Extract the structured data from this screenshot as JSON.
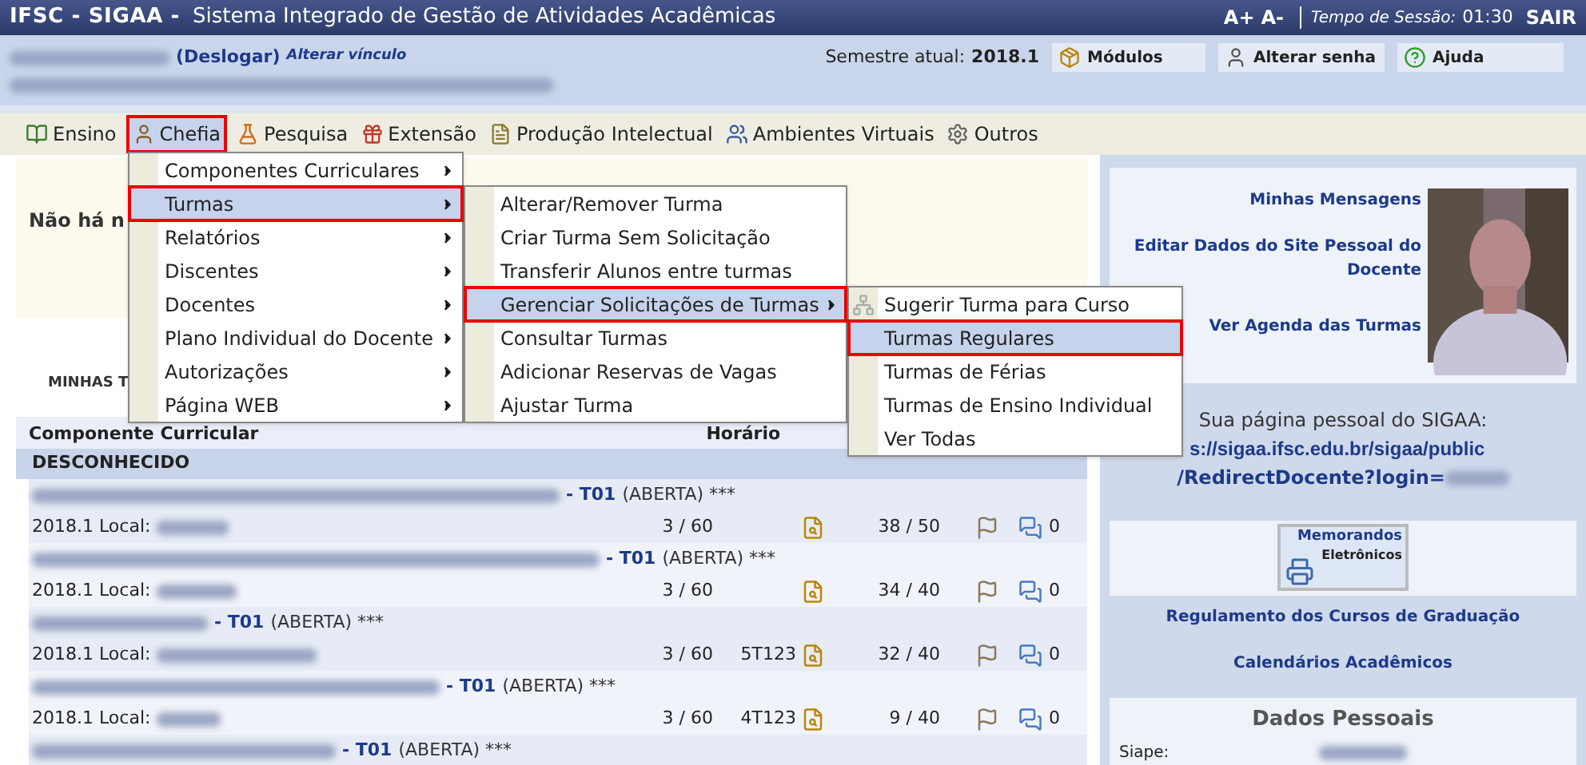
{
  "header": {
    "system": "IFSC - SIGAA -",
    "title": "Sistema Integrado de Gestão de Atividades Acadêmicas",
    "font_up": "A+",
    "font_down": "A-",
    "session_label": "Tempo de Sessão:",
    "session_time": "01:30",
    "logout": "SAIR"
  },
  "user_bar": {
    "logout_link": "(Deslogar)",
    "change_link": "Alterar vínculo",
    "semester_label": "Semestre atual:",
    "semester": "2018.1",
    "buttons": [
      "Módulos",
      "Alterar senha",
      "Ajuda"
    ]
  },
  "menu_bar": [
    {
      "label": "Ensino",
      "selected": false
    },
    {
      "label": "Chefia",
      "selected": true
    },
    {
      "label": "Pesquisa",
      "selected": false
    },
    {
      "label": "Extensão",
      "selected": false
    },
    {
      "label": "Produção Intelectual",
      "selected": false
    },
    {
      "label": "Ambientes Virtuais",
      "selected": false
    },
    {
      "label": "Outros",
      "selected": false
    }
  ],
  "menus": [
    {
      "items": [
        {
          "label": "Componentes Curriculares",
          "selected": false,
          "submenu": true
        },
        {
          "label": "Turmas",
          "selected": true,
          "submenu": true
        },
        {
          "label": "Relatórios",
          "selected": false,
          "submenu": true
        },
        {
          "label": "Discentes",
          "selected": false,
          "submenu": true
        },
        {
          "label": "Docentes",
          "selected": false,
          "submenu": true
        },
        {
          "label": "Plano Individual do Docente",
          "selected": false,
          "submenu": true
        },
        {
          "label": "Autorizações",
          "selected": false,
          "submenu": true
        },
        {
          "label": "Página WEB",
          "selected": false,
          "submenu": true
        }
      ]
    },
    {
      "items": [
        {
          "label": "Alterar/Remover Turma",
          "selected": false,
          "submenu": false
        },
        {
          "label": "Criar Turma Sem Solicitação",
          "selected": false,
          "submenu": false
        },
        {
          "label": "Transferir Alunos entre turmas",
          "selected": false,
          "submenu": false
        },
        {
          "label": "Gerenciar Solicitações de Turmas",
          "selected": true,
          "submenu": true
        },
        {
          "label": "Consultar Turmas",
          "selected": false,
          "submenu": false
        },
        {
          "label": "Adicionar Reservas de Vagas",
          "selected": false,
          "submenu": false
        },
        {
          "label": "Ajustar Turma",
          "selected": false,
          "submenu": false
        }
      ]
    },
    {
      "items": [
        {
          "label": "Sugerir Turma para Curso",
          "selected": false,
          "submenu": false
        },
        {
          "label": "Turmas Regulares",
          "selected": true,
          "submenu": false
        },
        {
          "label": "Turmas de Férias",
          "selected": false,
          "submenu": false
        },
        {
          "label": "Turmas de Ensino Individual",
          "selected": false,
          "submenu": false
        },
        {
          "label": "Ver Todas",
          "selected": false,
          "submenu": false
        }
      ]
    }
  ],
  "notice": "Não há n",
  "section_title": "MINHAS T",
  "table": {
    "columns": [
      "Componente Curricular",
      "Horário"
    ],
    "group": "DESCONHECIDO",
    "rows": [
      {
        "code": "- T01",
        "status": "(ABERTA) ***",
        "period": "2018.1 Local:",
        "workload": "3 / 60",
        "schedule": "",
        "seats": "38 / 50",
        "messages": "0"
      },
      {
        "code": "- T01",
        "status": "(ABERTA) ***",
        "period": "2018.1 Local:",
        "workload": "3 / 60",
        "schedule": "",
        "seats": "34 / 40",
        "messages": "0"
      },
      {
        "code": "- T01",
        "status": "(ABERTA) ***",
        "period": "2018.1 Local:",
        "workload": "3 / 60",
        "schedule": "5T123",
        "seats": "32 / 40",
        "messages": "0"
      },
      {
        "code": "- T01",
        "status": "(ABERTA) ***",
        "period": "2018.1 Local:",
        "workload": "3 / 60",
        "schedule": "4T123",
        "seats": "9 / 40",
        "messages": "0"
      },
      {
        "code": "- T01",
        "status": "(ABERTA) ***"
      }
    ]
  },
  "side": {
    "links": [
      "Minhas Mensagens",
      "Editar Dados do Site Pessoal do Docente",
      "Ver Agenda das Turmas"
    ],
    "page_label": "Sua página pessoal do SIGAA:",
    "page_url_1": "s://sigaa.ifsc.edu.br/sigaa/public",
    "page_url_2": "/RedirectDocente?login=",
    "memo_title": "Memorandos",
    "memo_subtitle": "Eletrônicos",
    "links_2": [
      "Regulamento dos Cursos de Graduação",
      "Calendários Acadêmicos"
    ],
    "personal_title": "Dados Pessoais",
    "siape_label": "Siape:"
  }
}
